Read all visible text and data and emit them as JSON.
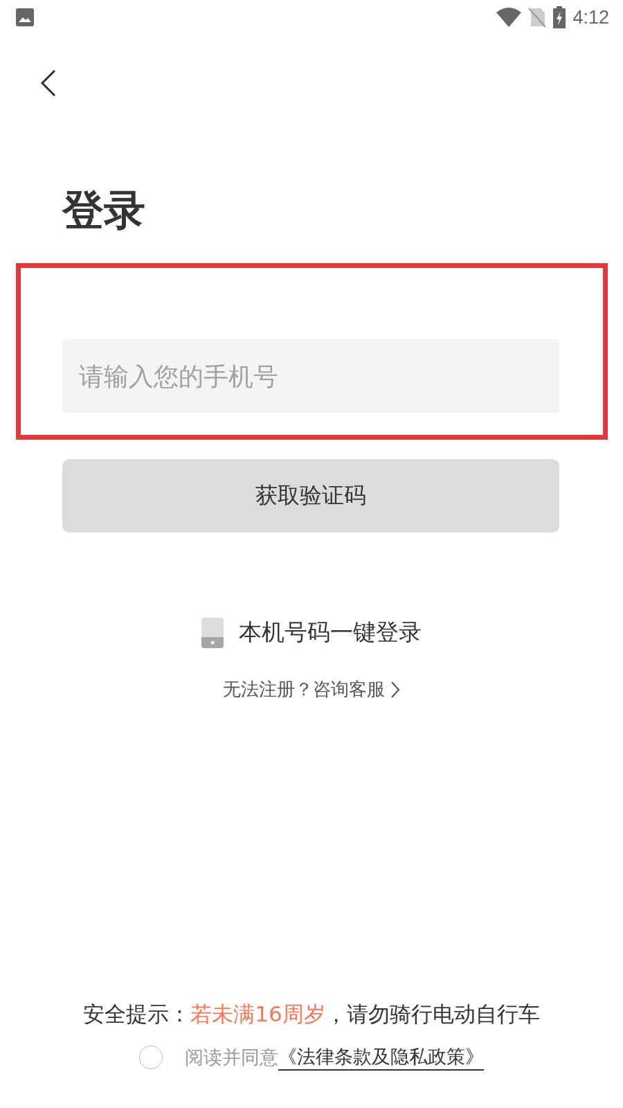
{
  "status_bar": {
    "time": "4:12"
  },
  "title": "登录",
  "highlight": {
    "shown": true
  },
  "phone_field": {
    "placeholder": "请输入您的手机号"
  },
  "code_button": {
    "label": "获取验证码",
    "disabled": true
  },
  "one_tap_login": {
    "label": "本机号码一键登录"
  },
  "help_link": {
    "label": "无法注册？咨询客服"
  },
  "safety_notice": {
    "parts": [
      {
        "text": "安全提示：",
        "kind": "plain"
      },
      {
        "text": "若未满16周岁",
        "kind": "warning"
      },
      {
        "text": "，请勿骑行电动自行车",
        "kind": "plain"
      }
    ]
  },
  "agreement": {
    "checked": false,
    "text": "阅读并同意",
    "link": "《法律条款及隐私政策》"
  }
}
